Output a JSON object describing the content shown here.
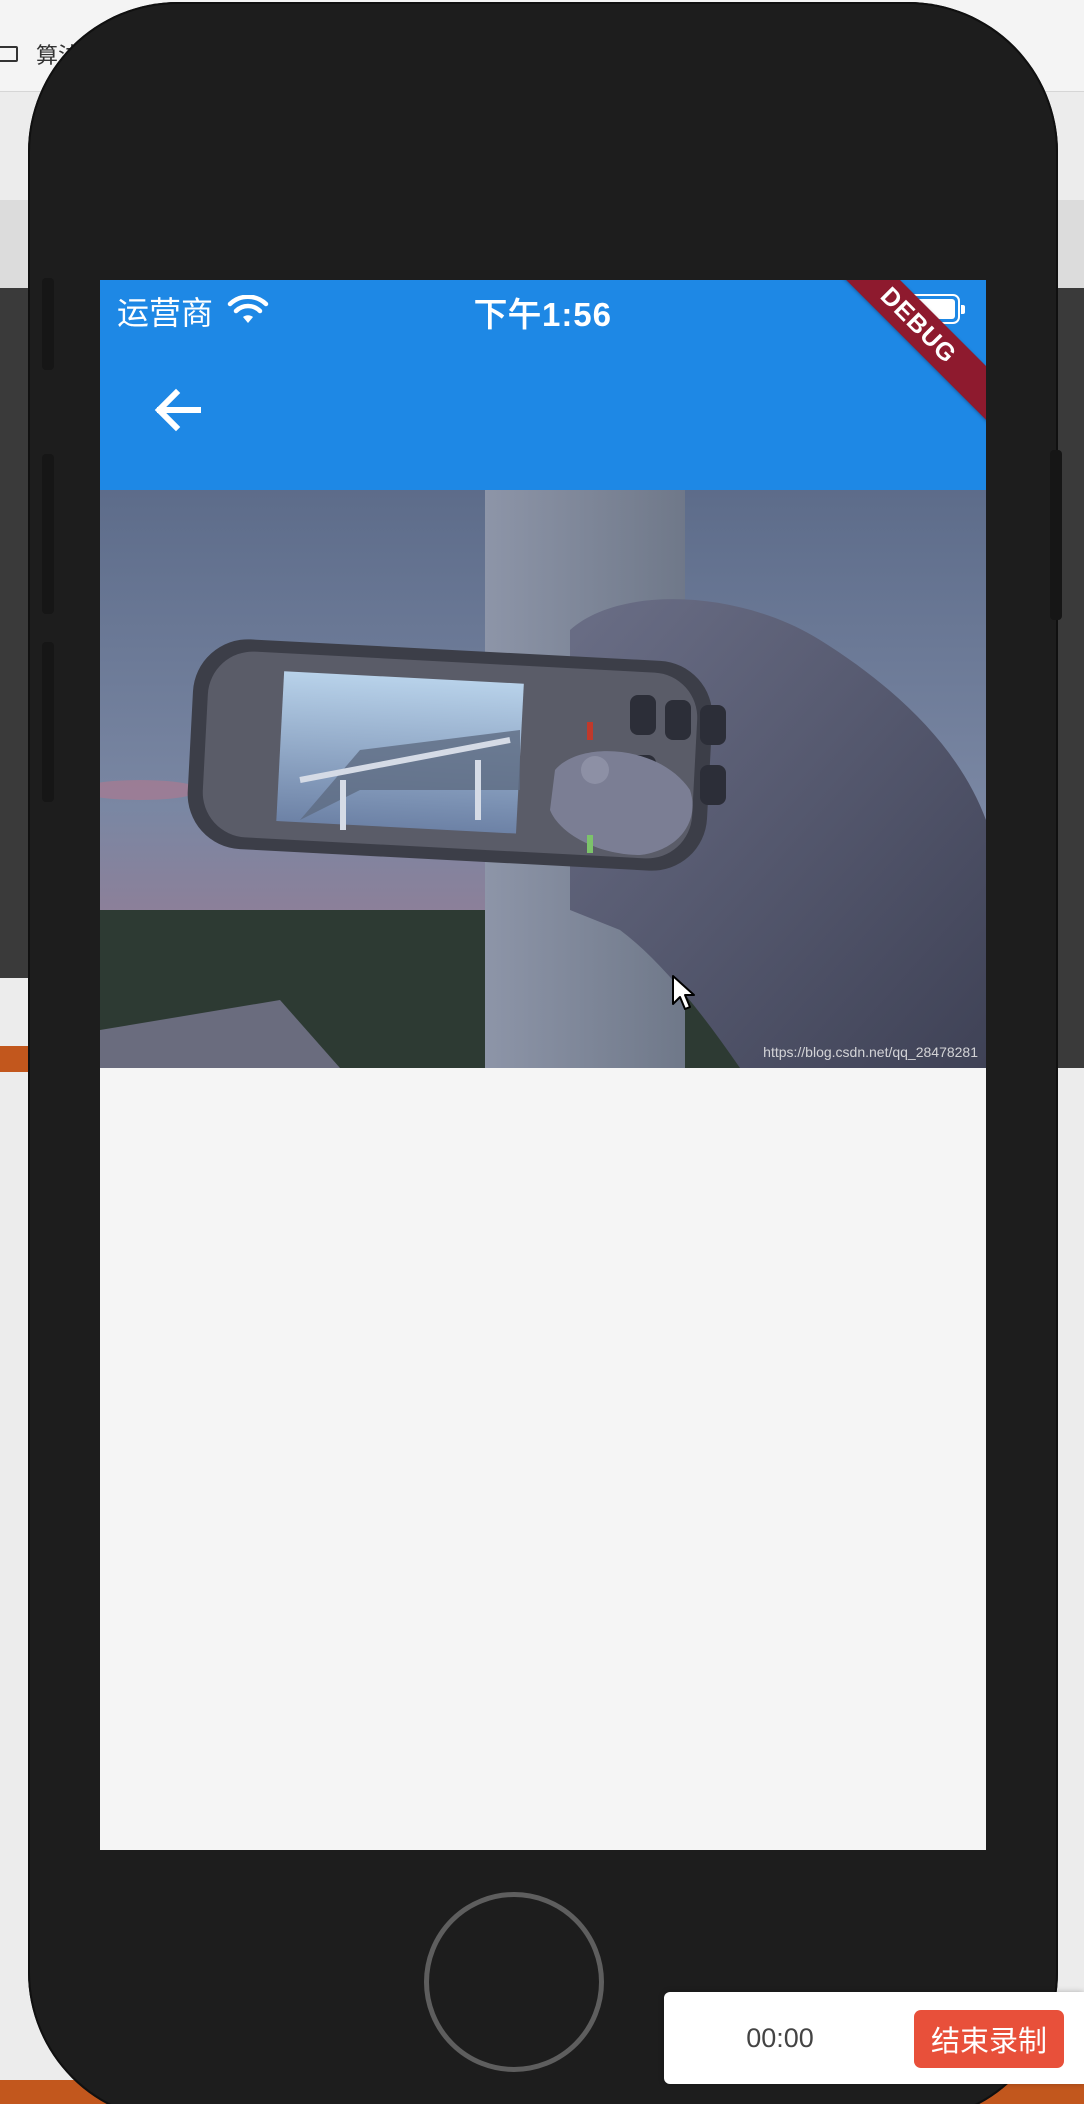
{
  "background": {
    "tab_text": "算法"
  },
  "status_bar": {
    "carrier": "运营商",
    "time": "下午1:56",
    "wifi_icon": "wifi-icon",
    "battery_icon": "battery-full-icon"
  },
  "app_bar": {
    "back_icon": "arrow-back-icon",
    "color": "#1e88e5",
    "debug_banner": "DEBUG"
  },
  "image": {
    "subject": "hand holding Nokia phone photographing a bridge",
    "watermark": "https://blog.csdn.net/qq_28478281"
  },
  "recorder": {
    "elapsed": "00:00",
    "stop_label": "结束录制",
    "stop_color": "#e8503a"
  }
}
